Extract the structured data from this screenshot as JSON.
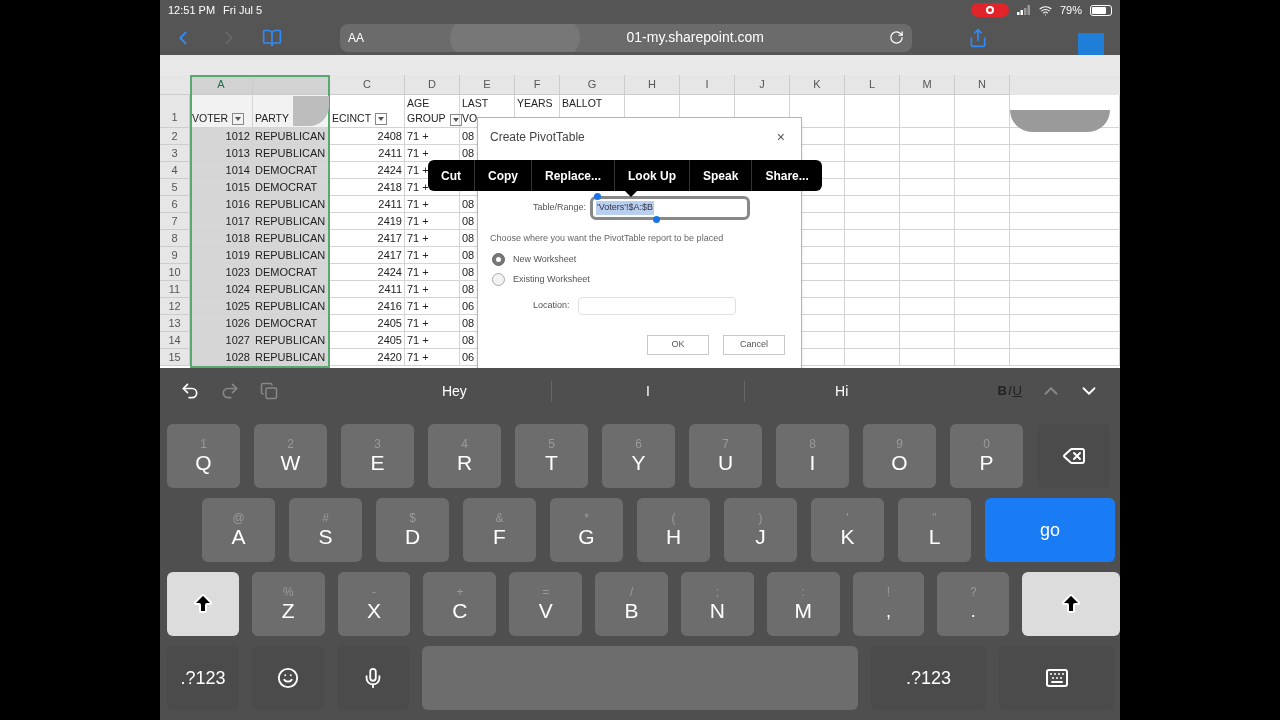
{
  "status_bar": {
    "time": "12:51 PM",
    "date": "Fri Jul 5",
    "recording": true,
    "battery": "79%"
  },
  "browser": {
    "text_size": "AA",
    "url": "01-my.sharepoint.com"
  },
  "sheet": {
    "columns": [
      {
        "header": "A",
        "selected": true
      },
      {
        "selected": true
      },
      {
        "header": "C",
        "selected": false
      },
      {
        "header": "D",
        "selected": false
      },
      {
        "header": "E",
        "selected": false
      },
      {
        "header": "F",
        "selected": false
      },
      {
        "header": "G",
        "selected": false
      },
      {
        "header": "H",
        "selected": false
      },
      {
        "header": "I",
        "selected": false
      },
      {
        "header": "J",
        "selected": false
      },
      {
        "header": "K",
        "selected": false
      },
      {
        "header": "L",
        "selected": false
      },
      {
        "header": "M",
        "selected": false
      },
      {
        "header": "N",
        "selected": false
      }
    ],
    "header_row": {
      "number": "1",
      "cells": [
        {
          "kind": "one_line",
          "lines": [
            "VOTER"
          ],
          "filter": true
        },
        {
          "kind": "one_line",
          "lines": [
            "PARTY"
          ],
          "filter": false
        },
        {
          "kind": "one_line",
          "lines": [
            "ECINCT"
          ],
          "filter": true
        },
        {
          "kind": "two_line",
          "lines": [
            "AGE",
            "GROUP"
          ],
          "filter": true
        },
        {
          "kind": "two_line",
          "lines": [
            "LAST",
            "VO"
          ],
          "filter": false
        },
        {
          "kind": "two_line",
          "lines": [
            "YEARS"
          ],
          "filter": false
        },
        {
          "kind": "two_line",
          "lines": [
            "BALLOT"
          ],
          "filter": false
        }
      ]
    },
    "rows": [
      {
        "number": "2",
        "voter": "1012",
        "party": "REPUBLICAN",
        "precinct": "2408",
        "age": "71 +",
        "last": "08"
      },
      {
        "number": "3",
        "voter": "1013",
        "party": "REPUBLICAN",
        "precinct": "2411",
        "age": "71 +",
        "last": "08"
      },
      {
        "number": "4",
        "voter": "1014",
        "party": "DEMOCRAT",
        "precinct": "2424",
        "age": "71 +"
      },
      {
        "number": "5",
        "voter": "1015",
        "party": "DEMOCRAT",
        "precinct": "2418",
        "age": "71 +"
      },
      {
        "number": "6",
        "voter": "1016",
        "party": "REPUBLICAN",
        "precinct": "2411",
        "age": "71 +",
        "last": "08"
      },
      {
        "number": "7",
        "voter": "1017",
        "party": "REPUBLICAN",
        "precinct": "2419",
        "age": "71 +",
        "last": "08"
      },
      {
        "number": "8",
        "voter": "1018",
        "party": "REPUBLICAN",
        "precinct": "2417",
        "age": "71 +",
        "last": "08"
      },
      {
        "number": "9",
        "voter": "1019",
        "party": "REPUBLICAN",
        "precinct": "2417",
        "age": "71 +",
        "last": "08"
      },
      {
        "number": "10",
        "voter": "1023",
        "party": "DEMOCRAT",
        "precinct": "2424",
        "age": "71 +",
        "last": "08"
      },
      {
        "number": "11",
        "voter": "1024",
        "party": "REPUBLICAN",
        "precinct": "2411",
        "age": "71 +",
        "last": "08"
      },
      {
        "number": "12",
        "voter": "1025",
        "party": "REPUBLICAN",
        "precinct": "2416",
        "age": "71 +",
        "last": "06"
      },
      {
        "number": "13",
        "voter": "1026",
        "party": "DEMOCRAT",
        "precinct": "2405",
        "age": "71 +",
        "last": "08"
      },
      {
        "number": "14",
        "voter": "1027",
        "party": "REPUBLICAN",
        "precinct": "2405",
        "age": "71 +",
        "last": "08"
      },
      {
        "number": "15",
        "voter": "1028",
        "party": "REPUBLICAN",
        "precinct": "2420",
        "age": "71 +",
        "last": "06"
      }
    ]
  },
  "dialog": {
    "title": "Create PivotTable",
    "close": "×",
    "range_label": "Table/Range:",
    "range_value": "'Voters'!$A:$B",
    "placement_prompt": "Choose where you want the PivotTable report to be placed",
    "options": [
      {
        "label": "New Worksheet",
        "selected": true
      },
      {
        "label": "Existing Worksheet",
        "selected": false
      }
    ],
    "location_label": "Location:",
    "buttons": [
      "OK",
      "Cancel"
    ]
  },
  "context_menu": [
    "Cut",
    "Copy",
    "Replace...",
    "Look Up",
    "Speak",
    "Share..."
  ],
  "keyboard": {
    "suggestions": [
      "Hey",
      "I",
      "Hi"
    ],
    "format": [
      {
        "label": "B",
        "kind": "bold"
      },
      {
        "label": "I",
        "kind": "italic"
      },
      {
        "label": "U",
        "kind": "underline"
      }
    ],
    "rows": [
      [
        {
          "kind": "letter",
          "label": "Q",
          "hint": "1"
        },
        {
          "kind": "letter",
          "label": "W",
          "hint": "2"
        },
        {
          "kind": "letter",
          "label": "E",
          "hint": "3"
        },
        {
          "kind": "letter",
          "label": "R",
          "hint": "4"
        },
        {
          "kind": "letter",
          "label": "T",
          "hint": "5"
        },
        {
          "kind": "letter",
          "label": "Y",
          "hint": "6"
        },
        {
          "kind": "letter",
          "label": "U",
          "hint": "7"
        },
        {
          "kind": "letter",
          "label": "I",
          "hint": "8"
        },
        {
          "kind": "letter",
          "label": "O",
          "hint": "9"
        },
        {
          "kind": "letter",
          "label": "P",
          "hint": "0"
        },
        {
          "kind": "backspace"
        }
      ],
      [
        {
          "kind": "letter",
          "label": "A",
          "hint": "@"
        },
        {
          "kind": "letter",
          "label": "S",
          "hint": "#"
        },
        {
          "kind": "letter",
          "label": "D",
          "hint": "$"
        },
        {
          "kind": "letter",
          "label": "F",
          "hint": "&"
        },
        {
          "kind": "letter",
          "label": "G",
          "hint": "*"
        },
        {
          "kind": "letter",
          "label": "H",
          "hint": "("
        },
        {
          "kind": "letter",
          "label": "J",
          "hint": ")"
        },
        {
          "kind": "letter",
          "label": "K",
          "hint": "'"
        },
        {
          "kind": "letter",
          "label": "L",
          "hint": "\""
        },
        {
          "kind": "go",
          "label": "go"
        }
      ],
      [
        {
          "kind": "shift"
        },
        {
          "kind": "letter",
          "label": "Z",
          "hint": "%"
        },
        {
          "kind": "letter",
          "label": "X",
          "hint": "-"
        },
        {
          "kind": "letter",
          "label": "C",
          "hint": "+"
        },
        {
          "kind": "letter",
          "label": "V",
          "hint": "="
        },
        {
          "kind": "letter",
          "label": "B",
          "hint": "/"
        },
        {
          "kind": "letter",
          "label": "N",
          "hint": ";"
        },
        {
          "kind": "letter",
          "label": "M",
          "hint": ":"
        },
        {
          "kind": "punct",
          "label": ",",
          "hint": "!"
        },
        {
          "kind": "punct",
          "label": ".",
          "hint": "?"
        },
        {
          "kind": "shift_wide"
        }
      ],
      [
        {
          "kind": "numbers",
          "label": ".?123"
        },
        {
          "kind": "emoji"
        },
        {
          "kind": "mic"
        },
        {
          "kind": "space"
        },
        {
          "kind": "numbers_wide",
          "label": ".?123"
        },
        {
          "kind": "dismiss"
        }
      ]
    ]
  }
}
